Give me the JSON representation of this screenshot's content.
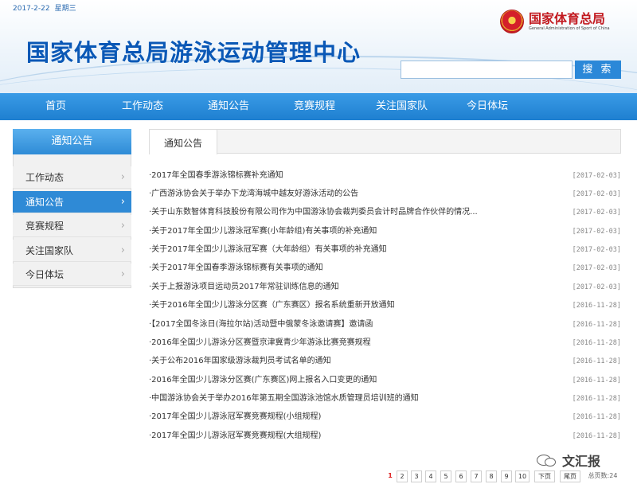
{
  "header": {
    "date": "2017-2-22",
    "weekday": "星期三",
    "site_title": "国家体育总局游泳运动管理中心",
    "logo_cn": "国家体育总局",
    "logo_en": "General Administration of Sport of China",
    "search_button": "搜 索",
    "search_value": ""
  },
  "nav": {
    "items": [
      "首页",
      "工作动态",
      "通知公告",
      "竞赛规程",
      "关注国家队",
      "今日体坛"
    ]
  },
  "sidebar": {
    "heading": "通知公告",
    "items": [
      {
        "label": "工作动态",
        "active": false
      },
      {
        "label": "通知公告",
        "active": true
      },
      {
        "label": "竞赛规程",
        "active": false
      },
      {
        "label": "关注国家队",
        "active": false
      },
      {
        "label": "今日体坛",
        "active": false
      }
    ],
    "chevron_icon": "chevron-right-icon"
  },
  "main": {
    "tab_label": "通知公告",
    "news": [
      {
        "title": "·2017年全国春季游泳锦标赛补充通知",
        "date": "[2017-02-03]"
      },
      {
        "title": "·广西游泳协会关于举办下龙湾海城中越友好游泳活动的公告",
        "date": "[2017-02-03]"
      },
      {
        "title": "·关于山东数智体育科技股份有限公司作为中国游泳协会裁判委员会计时品牌合作伙伴的情况...",
        "date": "[2017-02-03]"
      },
      {
        "title": "·关于2017年全国少儿游泳冠军赛(小年龄组)有关事项的补充通知",
        "date": "[2017-02-03]"
      },
      {
        "title": "·关于2017年全国少儿游泳冠军赛（大年龄组）有关事项的补充通知",
        "date": "[2017-02-03]"
      },
      {
        "title": "·关于2017年全国春季游泳锦标赛有关事项的通知",
        "date": "[2017-02-03]"
      },
      {
        "title": "·关于上报游泳项目运动员2017年常驻训练信息的通知",
        "date": "[2017-02-03]"
      },
      {
        "title": "·关于2016年全国少儿游泳分区赛（广东赛区）报名系统重新开放通知",
        "date": "[2016-11-28]"
      },
      {
        "title": "·【2017全国冬泳日(海拉尔站)活动暨中俄蒙冬泳邀请赛】邀请函",
        "date": "[2016-11-28]"
      },
      {
        "title": "·2016年全国少儿游泳分区赛暨京津冀青少年游泳比赛竞赛规程",
        "date": "[2016-11-28]"
      },
      {
        "title": "·关于公布2016年国家级游泳裁判员考试名单的通知",
        "date": "[2016-11-28]"
      },
      {
        "title": "·2016年全国少儿游泳分区赛(广东赛区)网上报名入口变更的通知",
        "date": "[2016-11-28]"
      },
      {
        "title": "·中国游泳协会关于举办2016年第五期全国游泳池馆水质管理员培训班的通知",
        "date": "[2016-11-28]"
      },
      {
        "title": "·2017年全国少儿游泳冠军赛竞赛规程(小组规程)",
        "date": "[2016-11-28]"
      },
      {
        "title": "·2017年全国少儿游泳冠军赛竞赛规程(大组规程)",
        "date": "[2016-11-28]"
      }
    ]
  },
  "pagination": {
    "pages": [
      "1",
      "2",
      "3",
      "4",
      "5",
      "6",
      "7",
      "8",
      "9",
      "10"
    ],
    "current": "1",
    "next": "下页",
    "last": "尾页",
    "total": "总页数:24"
  },
  "watermark": {
    "text": "文汇报",
    "icon": "wechat-icon"
  },
  "colors": {
    "title_blue": "#0a58b6",
    "nav_blue": "#1e7fd0",
    "active_blue": "#2f8ad6",
    "logo_red": "#c21a20",
    "current_page_red": "#dd2222"
  }
}
